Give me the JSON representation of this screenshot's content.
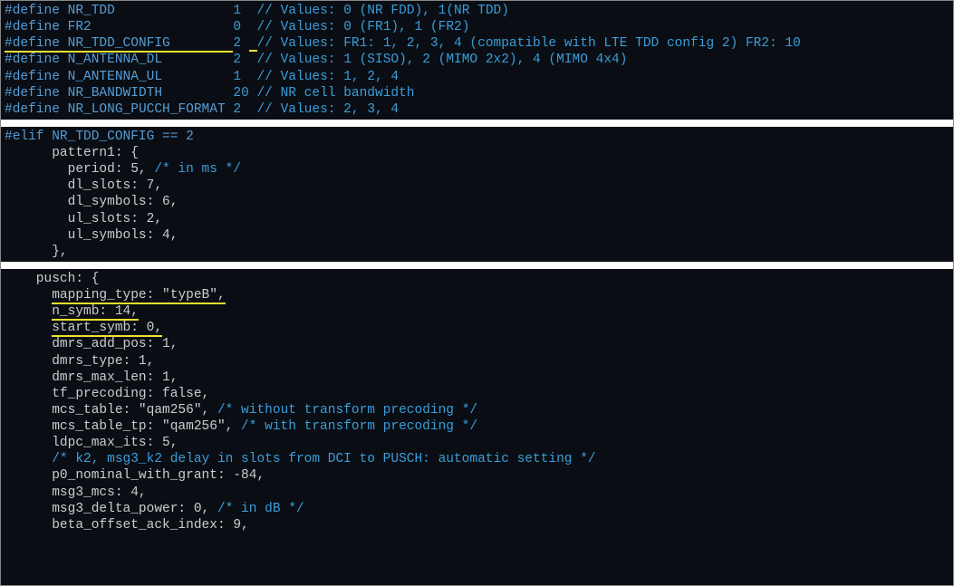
{
  "defs": {
    "nr_tdd": {
      "name": "NR_TDD",
      "val": "1 ",
      "cmt": "// Values: 0 (NR FDD), 1(NR TDD)"
    },
    "fr2": {
      "name": "FR2",
      "val": "0 ",
      "cmt": "// Values: 0 (FR1), 1 (FR2)"
    },
    "nr_tdd_config": {
      "name": "NR_TDD_CONFIG",
      "val": "2 ",
      "cmt": "// Values: FR1: 1, 2, 3, 4 (compatible with LTE TDD config 2) FR2: 10"
    },
    "n_ant_dl": {
      "name": "N_ANTENNA_DL",
      "val": "2 ",
      "cmt": "// Values: 1 (SISO), 2 (MIMO 2x2), 4 (MIMO 4x4)"
    },
    "n_ant_ul": {
      "name": "N_ANTENNA_UL",
      "val": "1 ",
      "cmt": "// Values: 1, 2, 4"
    },
    "nr_bw": {
      "name": "NR_BANDWIDTH",
      "val": "20",
      "cmt": "// NR cell bandwidth"
    },
    "nr_long_pucch": {
      "name": "NR_LONG_PUCCH_FORMAT",
      "val": "2 ",
      "cmt": "// Values: 2, 3, 4"
    }
  },
  "elif_line": "#elif NR_TDD_CONFIG == 2",
  "pattern1": {
    "open": "      pattern1: {",
    "period": "        period: 5, ",
    "period_cmt": "/* in ms */",
    "dl_slots": "        dl_slots: 7,",
    "dl_symbols": "        dl_symbols: 6,",
    "ul_slots": "        ul_slots: 2,",
    "ul_symbols": "        ul_symbols: 4,",
    "close": "      },"
  },
  "pusch": {
    "open": "    pusch: {",
    "mapping_type": "      mapping_type: \"typeB\",",
    "n_symb": "      n_symb: 14,",
    "start_symb": "      start_symb: 0,",
    "dmrs_add_pos": "      dmrs_add_pos: 1,",
    "dmrs_type": "      dmrs_type: 1,",
    "dmrs_max_len": "      dmrs_max_len: 1,",
    "tf_precoding": "      tf_precoding: false,",
    "mcs_table": "      mcs_table: \"qam256\", ",
    "mcs_table_cmt": "/* without transform precoding */",
    "mcs_table_tp": "      mcs_table_tp: \"qam256\", ",
    "mcs_table_tp_cmt": "/* with transform precoding */",
    "ldpc_max_its": "      ldpc_max_its: 5,",
    "k2_cmt": "      /* k2, msg3_k2 delay in slots from DCI to PUSCH: automatic setting */",
    "p0_nominal": "      p0_nominal_with_grant: -84,",
    "msg3_mcs": "      msg3_mcs: 4,",
    "msg3_delta": "      msg3_delta_power: 0, ",
    "msg3_delta_cmt": "/* in dB */",
    "beta_offset": "      beta_offset_ack_index: 9,"
  }
}
